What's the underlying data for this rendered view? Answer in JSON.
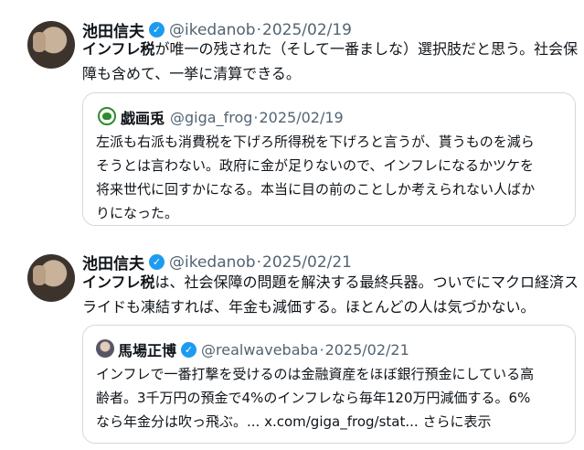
{
  "posts": [
    {
      "author_name": "池田信夫",
      "handle": "@ikedanob",
      "separator": "·",
      "date": "2025/02/19",
      "text_bold": "インフレ税",
      "text_line1_rest": "が唯一の残された（そして一番ましな）選択肢だと思う。社会保",
      "text_line2": "障も含めて、一挙に清算できる。",
      "quote": {
        "author_name": "戯画兎",
        "handle": "@giga_frog",
        "separator": "·",
        "date": "2025/02/19",
        "lines": [
          "左派も右派も消費税を下げろ所得税を下げろと言うが、貰うものを減ら",
          "そうとは言わない。政府に金が足りないので、インフレになるかツケを",
          "将来世代に回すかになる。本当に目の前のことしか考えられない人ばか",
          "りになった。"
        ]
      }
    },
    {
      "author_name": "池田信夫",
      "handle": "@ikedanob",
      "separator": "·",
      "date": "2025/02/21",
      "text_bold": "インフレ税",
      "text_line1_rest": "は、社会保障の問題を解決する最終兵器。ついでにマクロ経済ス",
      "text_line2": "ライドも凍結すれば、年金も減価する。ほとんどの人は気づかない。",
      "quote": {
        "author_name": "馬場正博",
        "handle": "@realwavebaba",
        "separator": "·",
        "date": "2025/02/21",
        "lines": [
          "インフレで一番打撃を受けるのは金融資産をほぼ銀行預金にしている高",
          "齢者。3千万円の預金で4%のインフレなら毎年120万円減価する。6%"
        ],
        "line3_text": "なら年金分は吹っ飛ぶ。... x.com/giga_frog/stat...",
        "show_more": "さらに表示"
      }
    }
  ],
  "icons": {
    "verified": "verified-badge-icon"
  },
  "colors": {
    "accent": "#1d9bf0",
    "muted": "#536471",
    "border": "#cfd9de"
  }
}
